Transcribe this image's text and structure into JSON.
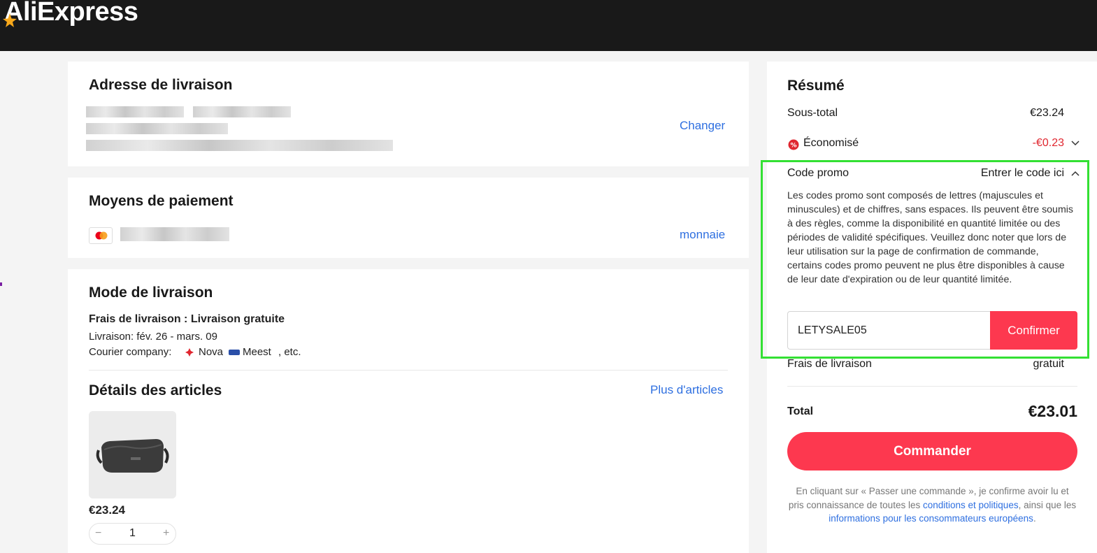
{
  "header": {
    "logo_text": "AliExpress",
    "brand_color": "#191919",
    "accent_color": "#fd384f"
  },
  "address": {
    "title": "Adresse de livraison",
    "change_label": "Changer"
  },
  "payment": {
    "title": "Moyens de paiement",
    "change_label": "monnaie",
    "card_icon": "mastercard-icon"
  },
  "shipping": {
    "title": "Mode de livraison",
    "fee_label": "Frais de livraison : Livraison gratuite",
    "delivery_label": "Livraison: fév. 26 - mars. 09",
    "courier_prefix": "Courier company:",
    "courier_1": "Nova",
    "courier_2": "Meest",
    "courier_suffix": ", etc."
  },
  "items": {
    "title": "Détails des articles",
    "more_label": "Plus d'articles",
    "product_price": "€23.24",
    "quantity": "1",
    "minus": "−",
    "plus": "+"
  },
  "summary": {
    "title": "Résumé",
    "subtotal_label": "Sous-total",
    "subtotal_value": "€23.24",
    "saved_label": "Économisé",
    "saved_value": "-€0.23",
    "promo_label": "Code promo",
    "promo_toggle": "Entrer le code ici",
    "promo_description": "Les codes promo sont composés de lettres (majuscules et minuscules) et de chiffres, sans espaces. Ils peuvent être soumis à des règles, comme la disponibilité en quantité limitée ou des périodes de validité spécifiques. Veuillez donc noter que lors de leur utilisation sur la page de confirmation de commande, certains codes promo peuvent ne plus être disponibles à cause de leur date d'expiration ou de leur quantité limitée.",
    "promo_code_value": "LETYSALE05",
    "confirm_label": "Confirmer",
    "shipping_label": "Frais de livraison",
    "shipping_value": "gratuit",
    "total_label": "Total",
    "total_value": "€23.01",
    "order_label": "Commander",
    "legal_1": "En cliquant sur « Passer une commande », je confirme avoir lu et pris connaissance de toutes les",
    "legal_link_1": "conditions et politiques",
    "legal_2": ", ainsi que les",
    "legal_link_2": "informations pour les consommateurs européens",
    "legal_3": "."
  }
}
